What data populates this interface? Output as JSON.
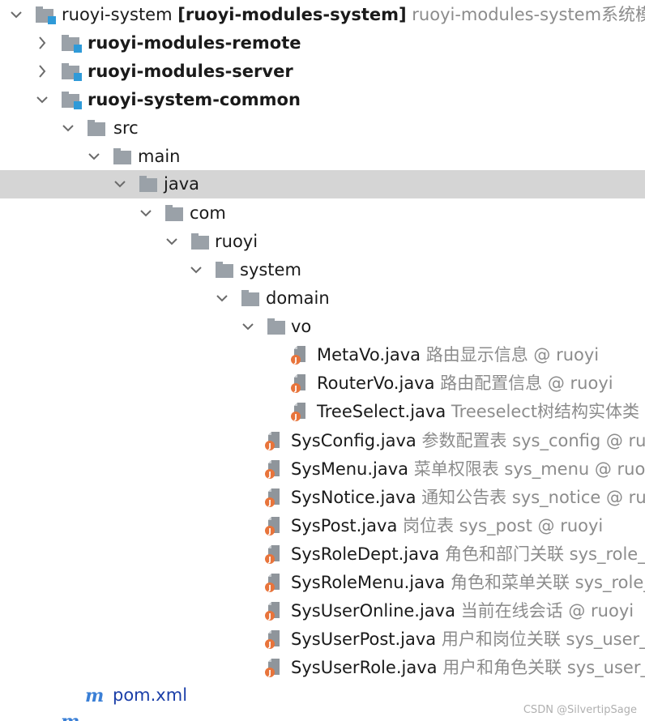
{
  "tree": {
    "root": {
      "name": "ruoyi-system",
      "bracket": "[ruoyi-modules-system]",
      "description": "ruoyi-modules-system系统模块",
      "icon": "module-folder-icon"
    },
    "modules": [
      {
        "name": "ruoyi-modules-remote",
        "icon": "module-folder-icon",
        "expanded": false
      },
      {
        "name": "ruoyi-modules-server",
        "icon": "module-folder-icon",
        "expanded": false
      },
      {
        "name": "ruoyi-system-common",
        "icon": "module-folder-icon",
        "expanded": true
      }
    ],
    "folders": [
      {
        "name": "src",
        "icon": "folder-icon"
      },
      {
        "name": "main",
        "icon": "folder-icon"
      },
      {
        "name": "java",
        "icon": "folder-icon",
        "selected": true
      },
      {
        "name": "com",
        "icon": "folder-icon"
      },
      {
        "name": "ruoyi",
        "icon": "folder-icon"
      },
      {
        "name": "system",
        "icon": "folder-icon"
      },
      {
        "name": "domain",
        "icon": "folder-icon"
      },
      {
        "name": "vo",
        "icon": "folder-icon"
      }
    ],
    "vo_files": [
      {
        "name": "MetaVo.java",
        "description": "路由显示信息 @ ruoyi",
        "icon": "java-class-icon"
      },
      {
        "name": "RouterVo.java",
        "description": "路由配置信息 @ ruoyi",
        "icon": "java-class-icon"
      },
      {
        "name": "TreeSelect.java",
        "description": "Treeselect树结构实体类 @",
        "icon": "java-class-icon"
      }
    ],
    "domain_files": [
      {
        "name": "SysConfig.java",
        "description": "参数配置表 sys_config @ ruoy",
        "icon": "java-class-icon"
      },
      {
        "name": "SysMenu.java",
        "description": "菜单权限表 sys_menu @ ruoyi",
        "icon": "java-class-icon"
      },
      {
        "name": "SysNotice.java",
        "description": "通知公告表 sys_notice @ ruoy",
        "icon": "java-class-icon"
      },
      {
        "name": "SysPost.java",
        "description": "岗位表 sys_post @ ruoyi",
        "icon": "java-class-icon"
      },
      {
        "name": "SysRoleDept.java",
        "description": "角色和部门关联 sys_role_de",
        "icon": "java-class-icon"
      },
      {
        "name": "SysRoleMenu.java",
        "description": "角色和菜单关联 sys_role_r",
        "icon": "java-class-icon"
      },
      {
        "name": "SysUserOnline.java",
        "description": "当前在线会话 @ ruoyi",
        "icon": "java-class-icon"
      },
      {
        "name": "SysUserPost.java",
        "description": "用户和岗位关联 sys_user_po",
        "icon": "java-class-icon"
      },
      {
        "name": "SysUserRole.java",
        "description": "用户和角色关联 sys_user_ro",
        "icon": "java-class-icon"
      }
    ],
    "pom": {
      "name": "pom.xml",
      "icon": "maven-icon"
    }
  },
  "watermark": "CSDN @SilvertipSage",
  "colors": {
    "selected_row": "#d5d5d5",
    "folder_gray": "#9aa1a8",
    "module_marker": "#2f9ad8",
    "java_badge": "#e8743b",
    "maven_blue": "#3a7fd6",
    "description_gray": "#8c8c8c"
  }
}
